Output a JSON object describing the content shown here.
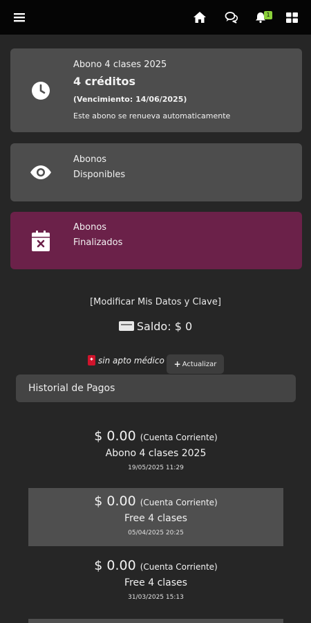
{
  "topbar": {
    "menu_icon": "hamburger-icon",
    "home_icon": "home-icon",
    "chat_icon": "chat-icon",
    "bell_icon": "bell-icon",
    "notification_count": "1",
    "grid_icon": "grid-icon"
  },
  "cards": {
    "abono_actual": {
      "title": "Abono 4 clases 2025",
      "credits": "4 créditos",
      "expiry": "(Vencimiento: 14/06/2025)",
      "renewal": "Este abono se renueva automaticamente",
      "icon": "clock-icon"
    },
    "disponibles": {
      "line1": "Abonos",
      "line2": "Disponibles",
      "icon": "eye-icon"
    },
    "finalizados": {
      "line1": "Abonos",
      "line2": "Finalizados",
      "icon": "calendar-x-icon",
      "color": "#6b2149"
    }
  },
  "account": {
    "modify_link": "[Modificar Mis Datos y Clave]",
    "saldo": "Saldo: $ 0",
    "apto_status": "sin apto médico",
    "update_button": "Actualizar"
  },
  "payments": {
    "header": "Historial de Pagos",
    "items": [
      {
        "amount": "$ 0.00",
        "account": "(Cuenta Corriente)",
        "description": "Abono 4 clases 2025",
        "date": "19/05/2025 11:29"
      },
      {
        "amount": "$ 0.00",
        "account": "(Cuenta Corriente)",
        "description": "Free 4 clases",
        "date": "05/04/2025 20:25"
      },
      {
        "amount": "$ 0.00",
        "account": "(Cuenta Corriente)",
        "description": "Free 4 clases",
        "date": "31/03/2025 15:13"
      }
    ]
  }
}
